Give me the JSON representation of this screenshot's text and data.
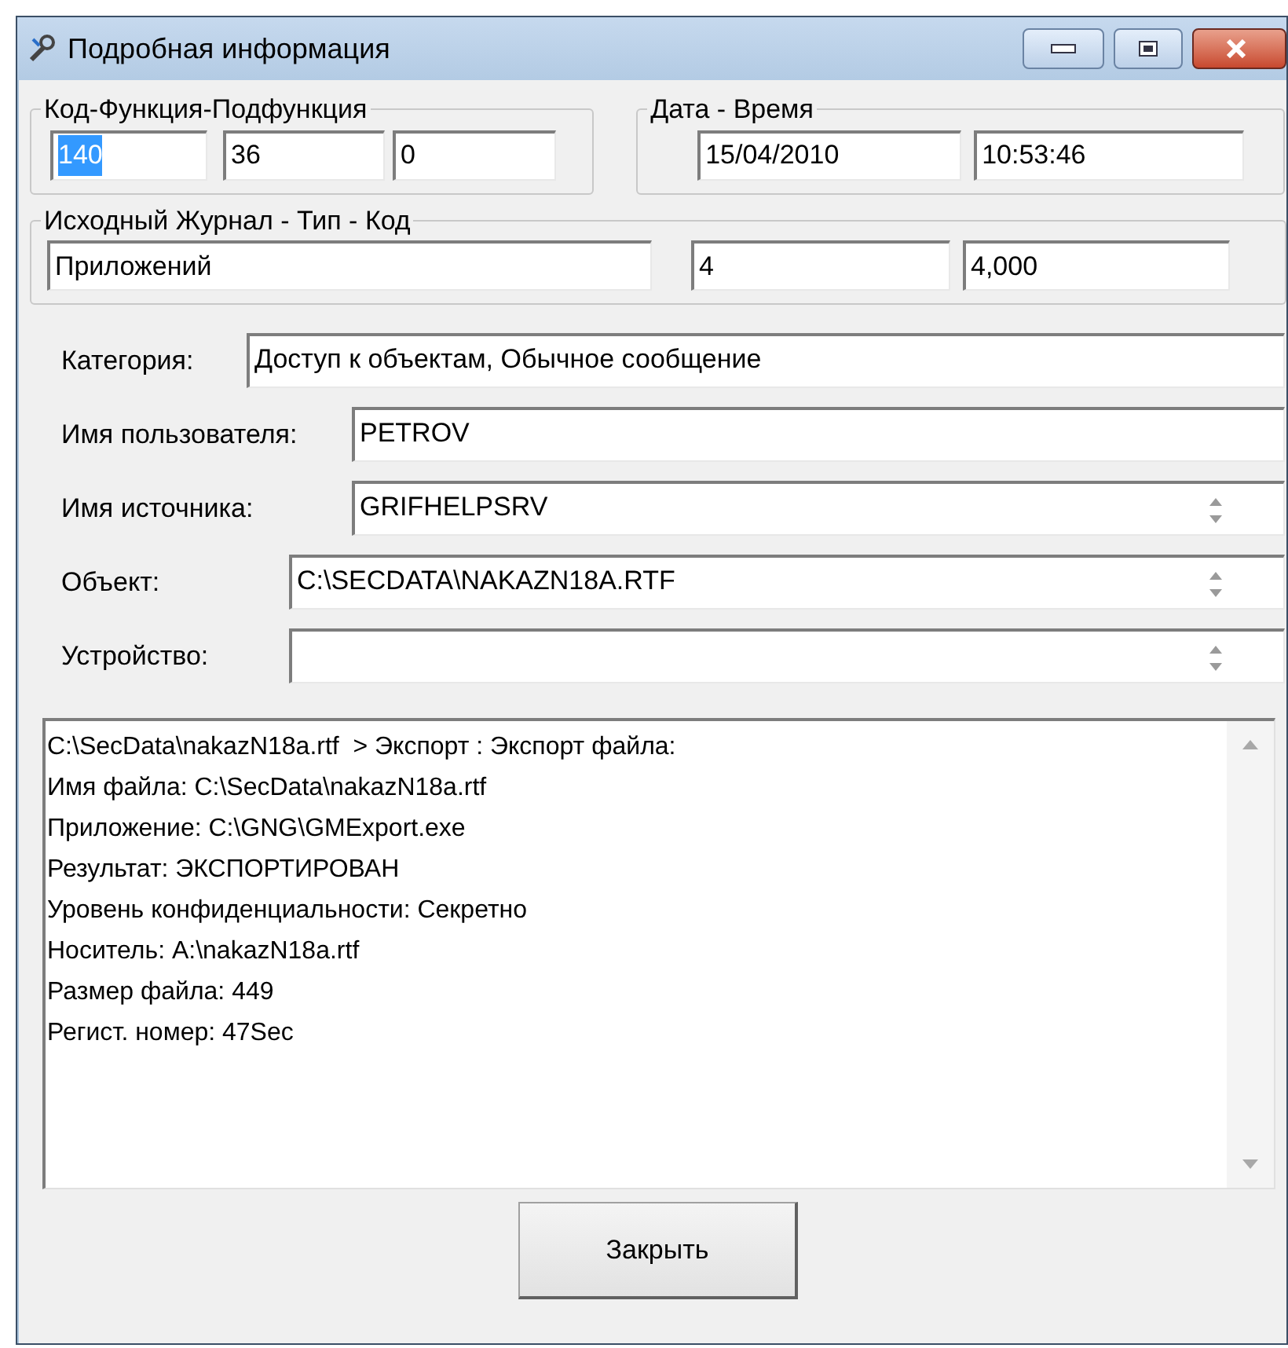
{
  "window": {
    "title": "Подробная информация"
  },
  "groups": [
    {
      "legend": "Код-Функция-Подфункция",
      "fields": [
        {
          "value": "140",
          "highlighted": true
        },
        {
          "value": "36",
          "highlighted": false
        },
        {
          "value": "0",
          "highlighted": false
        }
      ]
    },
    {
      "legend": "Дата - Время",
      "fields": [
        {
          "value": "15/04/2010",
          "highlighted": false
        },
        {
          "value": "10:53:46",
          "highlighted": false
        }
      ]
    },
    {
      "legend": "Исходный Журнал - Тип - Код",
      "fields": [
        {
          "value": "Приложений",
          "highlighted": false
        },
        {
          "value": "4",
          "highlighted": false
        },
        {
          "value": "4,000",
          "highlighted": false
        }
      ]
    }
  ],
  "rows": [
    {
      "label": "Категория:",
      "value": "Доступ к объектам, Обычное сообщение",
      "kind": "plain"
    },
    {
      "label": "Имя пользователя:",
      "value": "PETROV",
      "kind": "plain"
    },
    {
      "label": "Имя источника:",
      "value": "GRIFHELPSRV",
      "kind": "spin"
    },
    {
      "label": "Объект:",
      "value": "C:\\SECDATA\\NAKAZN18A.RTF",
      "kind": "spin"
    },
    {
      "label": "Устройство:",
      "kind": "spin"
    }
  ],
  "memo": {
    "lines": [
      "C:\\SecData\\nakazN18a.rtf  > Экспорт : Экспорт файла:",
      "Имя файла: C:\\SecData\\nakazN18a.rtf",
      "Приложение: C:\\GNG\\GMExport.exe",
      "Результат: ЭКСПОРТИРОВАН",
      "Уровень конфиденциальности: Секретно",
      "Носитель: A:\\nakazN18a.rtf",
      "Размер файла: 449",
      "Регист. номер: 47Sec"
    ]
  },
  "close_button": "Закрыть"
}
